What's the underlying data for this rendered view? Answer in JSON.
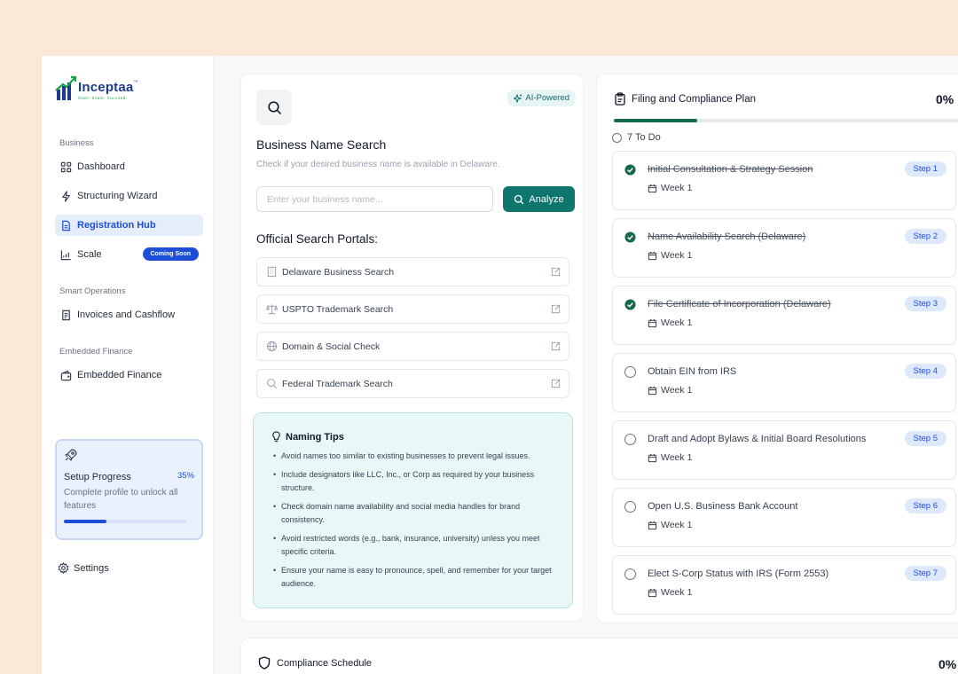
{
  "brand": {
    "name": "Inceptaa",
    "tm": "™",
    "tagline": "Start. Scale. Succeed.",
    "colors": {
      "primary": "#1d4ed8",
      "teal": "#0f766e",
      "green": "#166a4a"
    }
  },
  "sidebar": {
    "sections": [
      {
        "label": "Business"
      },
      {
        "label": "Smart Operations"
      },
      {
        "label": "Embedded Finance"
      }
    ],
    "items": [
      {
        "label": "Dashboard",
        "icon": "grid-icon"
      },
      {
        "label": "Structuring Wizard",
        "icon": "bolt-icon"
      },
      {
        "label": "Registration Hub",
        "icon": "document-icon",
        "active": true
      },
      {
        "label": "Scale",
        "icon": "chart-icon",
        "badge": "Coming Soon"
      },
      {
        "label": "Invoices and Cashflow",
        "icon": "receipt-icon"
      },
      {
        "label": "Embedded Finance",
        "icon": "wallet-icon"
      }
    ],
    "setup": {
      "title": "Setup Progress",
      "percent_label": "35%",
      "progress": 0.35,
      "description": "Complete profile to unlock all features"
    },
    "settings_label": "Settings"
  },
  "search": {
    "ai_badge": "AI-Powered",
    "title": "Business Name Search",
    "subtitle": "Check if your desired business name is available in Delaware.",
    "input_placeholder": "Enter your business name...",
    "analyze_label": "Analyze",
    "portals_title": "Official Search Portals:",
    "portals": [
      {
        "label": "Delaware Business Search",
        "icon": "building-icon"
      },
      {
        "label": "USPTO Trademark Search",
        "icon": "scale-icon"
      },
      {
        "label": "Domain & Social Check",
        "icon": "globe-icon"
      },
      {
        "label": "Federal Trademark Search",
        "icon": "search-icon"
      }
    ],
    "tips": {
      "title": "Naming Tips",
      "items": [
        "Avoid names too similar to existing businesses to prevent legal issues.",
        "Include designators like LLC, Inc., or Corp as required by your business structure.",
        "Check domain name availability and social media handles for brand consistency.",
        "Avoid restricted words (e.g., bank, insurance, university) unless you meet specific criteria.",
        "Ensure your name is easy to pronounce, spell, and remember for your target audience."
      ]
    }
  },
  "plan": {
    "title": "Filing and Compliance Plan",
    "percent_label": "0%",
    "progress": 0.24,
    "todo_label": "7 To Do",
    "steps": [
      {
        "title": "Initial Consultation & Strategy Session",
        "week": "Week 1",
        "badge": "Step 1",
        "done": true
      },
      {
        "title": "Name Availability Search (Delaware)",
        "week": "Week 1",
        "badge": "Step 2",
        "done": true
      },
      {
        "title": "File Certificate of Incorporation (Delaware)",
        "week": "Week 1",
        "badge": "Step 3",
        "done": true
      },
      {
        "title": "Obtain EIN from IRS",
        "week": "Week 1",
        "badge": "Step 4",
        "done": false
      },
      {
        "title": "Draft and Adopt Bylaws & Initial Board Resolutions",
        "week": "Week 1",
        "badge": "Step 5",
        "done": false
      },
      {
        "title": "Open U.S. Business Bank Account",
        "week": "Week 1",
        "badge": "Step 6",
        "done": false
      },
      {
        "title": "Elect S-Corp Status with IRS (Form 2553)",
        "week": "Week 1",
        "badge": "Step 7",
        "done": false
      }
    ]
  },
  "compliance": {
    "title": "Compliance Schedule",
    "percent_label": "0%"
  }
}
